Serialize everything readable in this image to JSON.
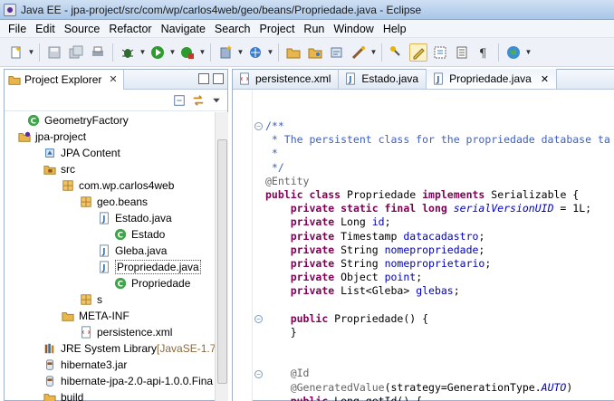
{
  "window": {
    "title": "Java EE - jpa-project/src/com/wp/carlos4web/geo/beans/Propriedade.java - Eclipse"
  },
  "menubar": {
    "items": [
      "File",
      "Edit",
      "Source",
      "Refactor",
      "Navigate",
      "Search",
      "Project",
      "Run",
      "Window",
      "Help"
    ]
  },
  "project_explorer": {
    "tab_label": "Project Explorer",
    "close_symbol": "✕",
    "tree": [
      {
        "label": "GeometryFactory",
        "icon": "class-icon"
      },
      {
        "label": "jpa-project",
        "icon": "project-icon"
      },
      {
        "label": "JPA Content",
        "icon": "jpa-content-icon"
      },
      {
        "label": "src",
        "icon": "source-folder-icon"
      },
      {
        "label": "com.wp.carlos4web",
        "icon": "package-icon"
      },
      {
        "label": "geo.beans",
        "icon": "package-icon"
      },
      {
        "label": "Estado.java",
        "icon": "java-file-icon"
      },
      {
        "label": "Estado",
        "icon": "class-icon"
      },
      {
        "label": "Gleba.java",
        "icon": "java-file-icon"
      },
      {
        "label": "Propriedade.java",
        "icon": "java-file-icon"
      },
      {
        "label": "Propriedade",
        "icon": "class-icon"
      },
      {
        "label": "s",
        "icon": "package-icon"
      },
      {
        "label": "META-INF",
        "icon": "folder-icon"
      },
      {
        "label": "persistence.xml",
        "icon": "xml-file-icon"
      },
      {
        "label": "JRE System Library",
        "decoration": "[JavaSE-1.7]",
        "icon": "library-icon"
      },
      {
        "label": "hibernate3.jar",
        "icon": "jar-icon"
      },
      {
        "label": "hibernate-jpa-2.0-api-1.0.0.Fina",
        "icon": "jar-icon"
      },
      {
        "label": "build",
        "icon": "folder-icon"
      }
    ]
  },
  "editor": {
    "tabs": [
      {
        "label": "persistence.xml",
        "icon": "xml-file-icon"
      },
      {
        "label": "Estado.java",
        "icon": "java-file-icon"
      },
      {
        "label": "Propriedade.java",
        "icon": "java-file-icon",
        "active": true,
        "close": "✕"
      }
    ],
    "code_lines": [
      [
        [
          "cm",
          "/**"
        ]
      ],
      [
        [
          "cm",
          " * The persistent class for the propriedade database ta"
        ]
      ],
      [
        [
          "cm",
          " * "
        ]
      ],
      [
        [
          "cm",
          " */"
        ]
      ],
      [
        [
          "an",
          "@Entity"
        ]
      ],
      [
        [
          "kw",
          "public class "
        ],
        [
          "",
          "Propriedade "
        ],
        [
          "kw",
          "implements "
        ],
        [
          "",
          "Serializable {"
        ]
      ],
      [
        [
          "",
          "    "
        ],
        [
          "kw",
          "private static final long "
        ],
        [
          "fd it",
          "serialVersionUID"
        ],
        [
          "",
          " = 1L;"
        ]
      ],
      [
        [
          "",
          "    "
        ],
        [
          "kw",
          "private "
        ],
        [
          "",
          "Long "
        ],
        [
          "fd",
          "id"
        ],
        [
          "",
          ";"
        ]
      ],
      [
        [
          "",
          "    "
        ],
        [
          "kw",
          "private "
        ],
        [
          "",
          "Timestamp "
        ],
        [
          "fd",
          "datacadastro"
        ],
        [
          "",
          ";"
        ]
      ],
      [
        [
          "",
          "    "
        ],
        [
          "kw",
          "private "
        ],
        [
          "",
          "String "
        ],
        [
          "fd",
          "nomepropriedade"
        ],
        [
          "",
          ";"
        ]
      ],
      [
        [
          "",
          "    "
        ],
        [
          "kw",
          "private "
        ],
        [
          "",
          "String "
        ],
        [
          "fd",
          "nomeproprietario"
        ],
        [
          "",
          ";"
        ]
      ],
      [
        [
          "",
          "    "
        ],
        [
          "kw",
          "private "
        ],
        [
          "",
          "Object "
        ],
        [
          "fd",
          "point"
        ],
        [
          "",
          ";"
        ]
      ],
      [
        [
          "",
          "    "
        ],
        [
          "kw",
          "private "
        ],
        [
          "",
          "List<Gleba> "
        ],
        [
          "fd",
          "glebas"
        ],
        [
          "",
          ";"
        ]
      ],
      [
        [
          "",
          ""
        ]
      ],
      [
        [
          "",
          "    "
        ],
        [
          "kw",
          "public "
        ],
        [
          "",
          "Propriedade() {"
        ]
      ],
      [
        [
          "",
          "    }"
        ]
      ],
      [
        [
          "",
          ""
        ]
      ],
      [
        [
          "",
          ""
        ]
      ],
      [
        [
          "",
          "    "
        ],
        [
          "an",
          "@Id"
        ]
      ],
      [
        [
          "",
          "    "
        ],
        [
          "an",
          "@GeneratedValue"
        ],
        [
          "",
          "(strategy=GenerationType."
        ],
        [
          "fd it",
          "AUTO"
        ],
        [
          "",
          ")"
        ]
      ],
      [
        [
          "",
          "    "
        ],
        [
          "kw",
          "public "
        ],
        [
          "",
          "Long getId() {"
        ]
      ]
    ]
  },
  "colors": {
    "keyword": "#7f0055",
    "comment": "#3f5fbf",
    "field": "#0000c0",
    "annotation": "#646464"
  }
}
